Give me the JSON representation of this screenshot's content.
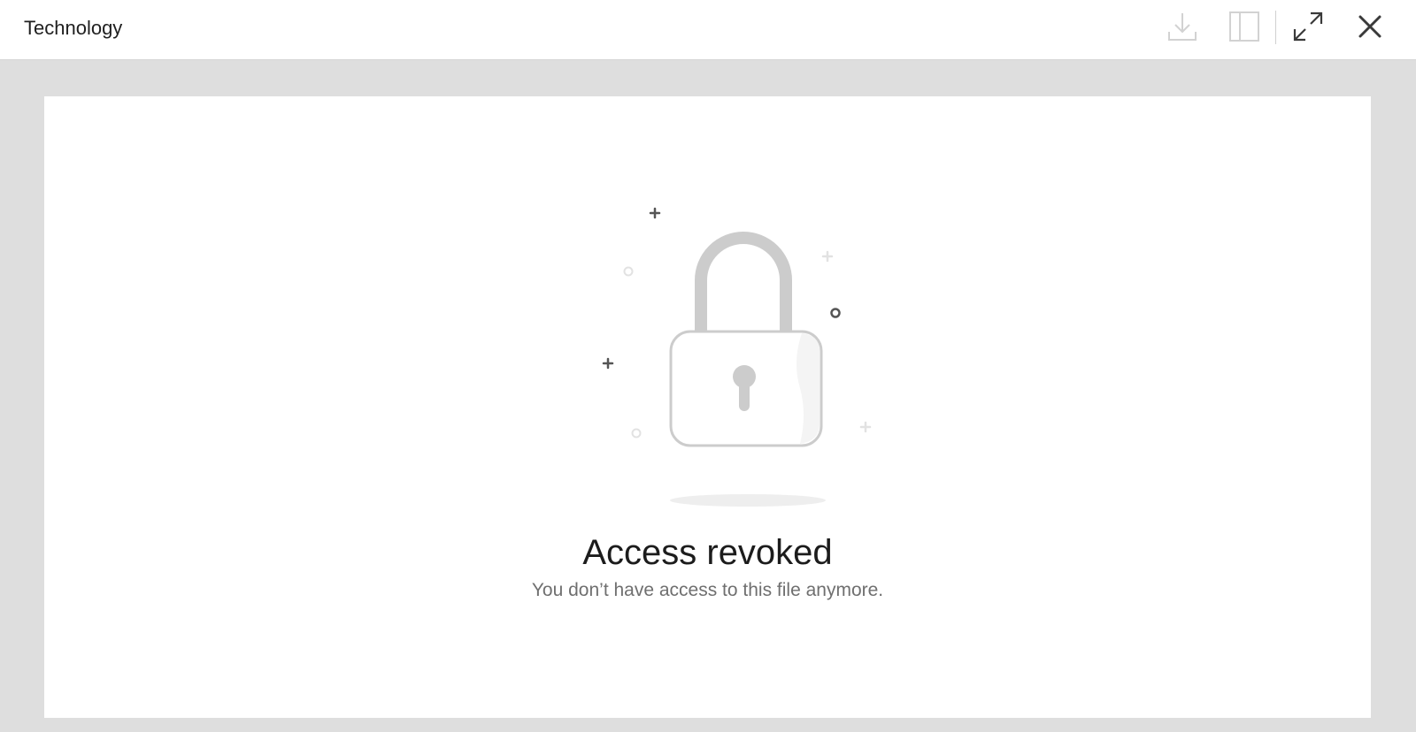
{
  "header": {
    "title": "Technology",
    "tools": [
      {
        "icon": "download-icon",
        "state": "disabled"
      },
      {
        "icon": "sidebar-panel-icon",
        "state": "disabled"
      },
      {
        "icon": "expand-icon",
        "state": "enabled"
      },
      {
        "icon": "close-icon",
        "state": "enabled"
      }
    ]
  },
  "viewer": {
    "illustration": "lock-icon",
    "heading": "Access revoked",
    "message": "You don’t have access to this file anymore."
  },
  "colors": {
    "background": "#dedede",
    "panel": "#ffffff",
    "disabled_icon": "#cfcfcf",
    "active_icon": "#3a3a3a"
  }
}
